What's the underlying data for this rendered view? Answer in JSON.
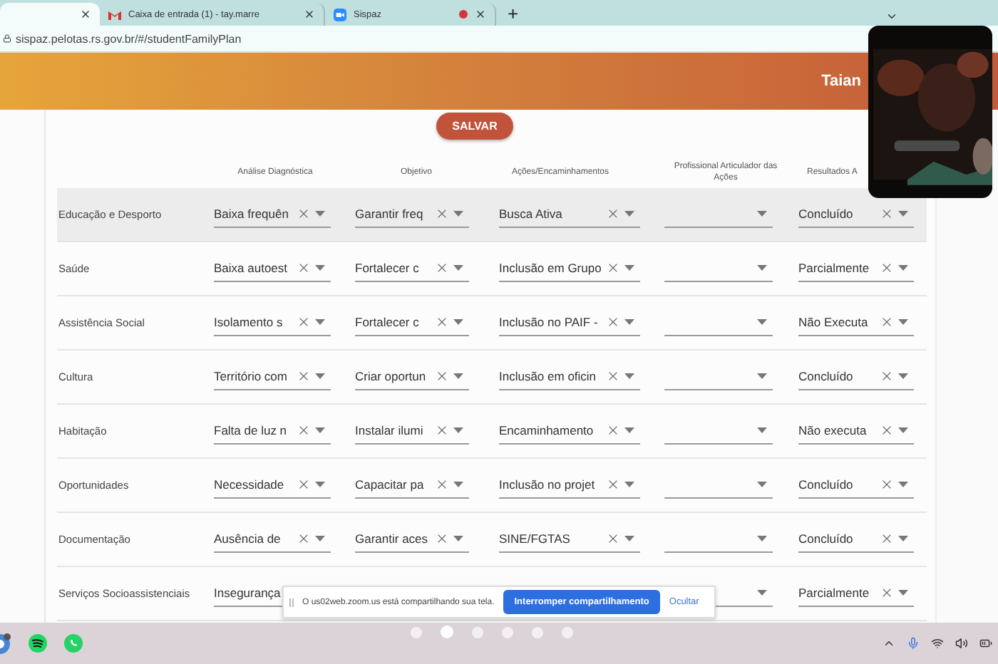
{
  "browser": {
    "tabs": [
      {
        "selected": true,
        "kind": "blank",
        "recording": false
      },
      {
        "title": "Caixa de entrada (1) - tay.marre",
        "selected": false,
        "kind": "mail",
        "recording": false
      },
      {
        "title": "Sispaz",
        "selected": false,
        "kind": "video",
        "recording": true
      }
    ],
    "new_tab": "+",
    "url": "sispaz.pelotas.rs.gov.br/#/studentFamilyPlan"
  },
  "header": {
    "user": "Taian"
  },
  "save_button": "SALVAR",
  "columns": [
    "Análise Diagnóstica",
    "Objetivo",
    "Ações/Encaminhamentos",
    "Profissional Articulador das Ações",
    "Resultados A"
  ],
  "rows": [
    {
      "area": "Educação e Desporto",
      "highlighted": true,
      "fields": [
        {
          "value": "Baixa frequên"
        },
        {
          "value": "Garantir freq"
        },
        {
          "value": "Busca Ativa"
        },
        {
          "kind": "empty"
        },
        {
          "value": "Concluído"
        }
      ]
    },
    {
      "area": "Saúde",
      "highlighted": false,
      "fields": [
        {
          "value": "Baixa autoest"
        },
        {
          "value": "Fortalecer c"
        },
        {
          "value": "Inclusão em Grupo"
        },
        {
          "kind": "empty"
        },
        {
          "value": "Parcialmente"
        }
      ]
    },
    {
      "area": "Assistência Social",
      "highlighted": false,
      "fields": [
        {
          "value": "Isolamento s"
        },
        {
          "value": "Fortalecer c"
        },
        {
          "value": "Inclusão no PAIF -"
        },
        {
          "kind": "empty"
        },
        {
          "value": "Não Executa"
        }
      ]
    },
    {
      "area": "Cultura",
      "highlighted": false,
      "fields": [
        {
          "value": "Território com"
        },
        {
          "value": "Criar oportun"
        },
        {
          "value": "Inclusão em oficin"
        },
        {
          "kind": "empty"
        },
        {
          "value": "Concluído"
        }
      ]
    },
    {
      "area": "Habitação",
      "highlighted": false,
      "fields": [
        {
          "value": "Falta de luz n"
        },
        {
          "value": "Instalar ilumi"
        },
        {
          "value": "Encaminhamento"
        },
        {
          "kind": "empty"
        },
        {
          "value": "Não executa"
        }
      ]
    },
    {
      "area": "Oportunidades",
      "highlighted": false,
      "fields": [
        {
          "value": "Necessidade"
        },
        {
          "value": "Capacitar pa"
        },
        {
          "value": "Inclusão no projet"
        },
        {
          "kind": "empty"
        },
        {
          "value": "Concluído"
        }
      ]
    },
    {
      "area": "Documentação",
      "highlighted": false,
      "fields": [
        {
          "value": "Ausência de"
        },
        {
          "value": "Garantir aces"
        },
        {
          "value": "SINE/FGTAS"
        },
        {
          "kind": "empty"
        },
        {
          "value": "Concluído"
        }
      ]
    },
    {
      "area": "Serviços Socioassistenciais",
      "highlighted": false,
      "fields": [
        {
          "kind": "partial",
          "value": "Insegurança"
        },
        {
          "kind": "covered"
        },
        {
          "kind": "covered"
        },
        {
          "kind": "empty"
        },
        {
          "value": "Parcialmente"
        }
      ]
    }
  ],
  "share_bar": {
    "message": "O us02web.zoom.us está compartilhando sua tela.",
    "stop_button": "Interromper compartilhamento",
    "hide_link": "Ocultar"
  },
  "video_overlay": {
    "kind": "picture"
  },
  "taskbar": {
    "apps": [
      {
        "kind": "browser"
      },
      {
        "kind": "music"
      },
      {
        "kind": "chat"
      }
    ],
    "dots": [
      {
        "selected": false
      },
      {
        "selected": true
      },
      {
        "selected": false
      },
      {
        "selected": false
      },
      {
        "selected": false
      },
      {
        "selected": false
      }
    ]
  }
}
